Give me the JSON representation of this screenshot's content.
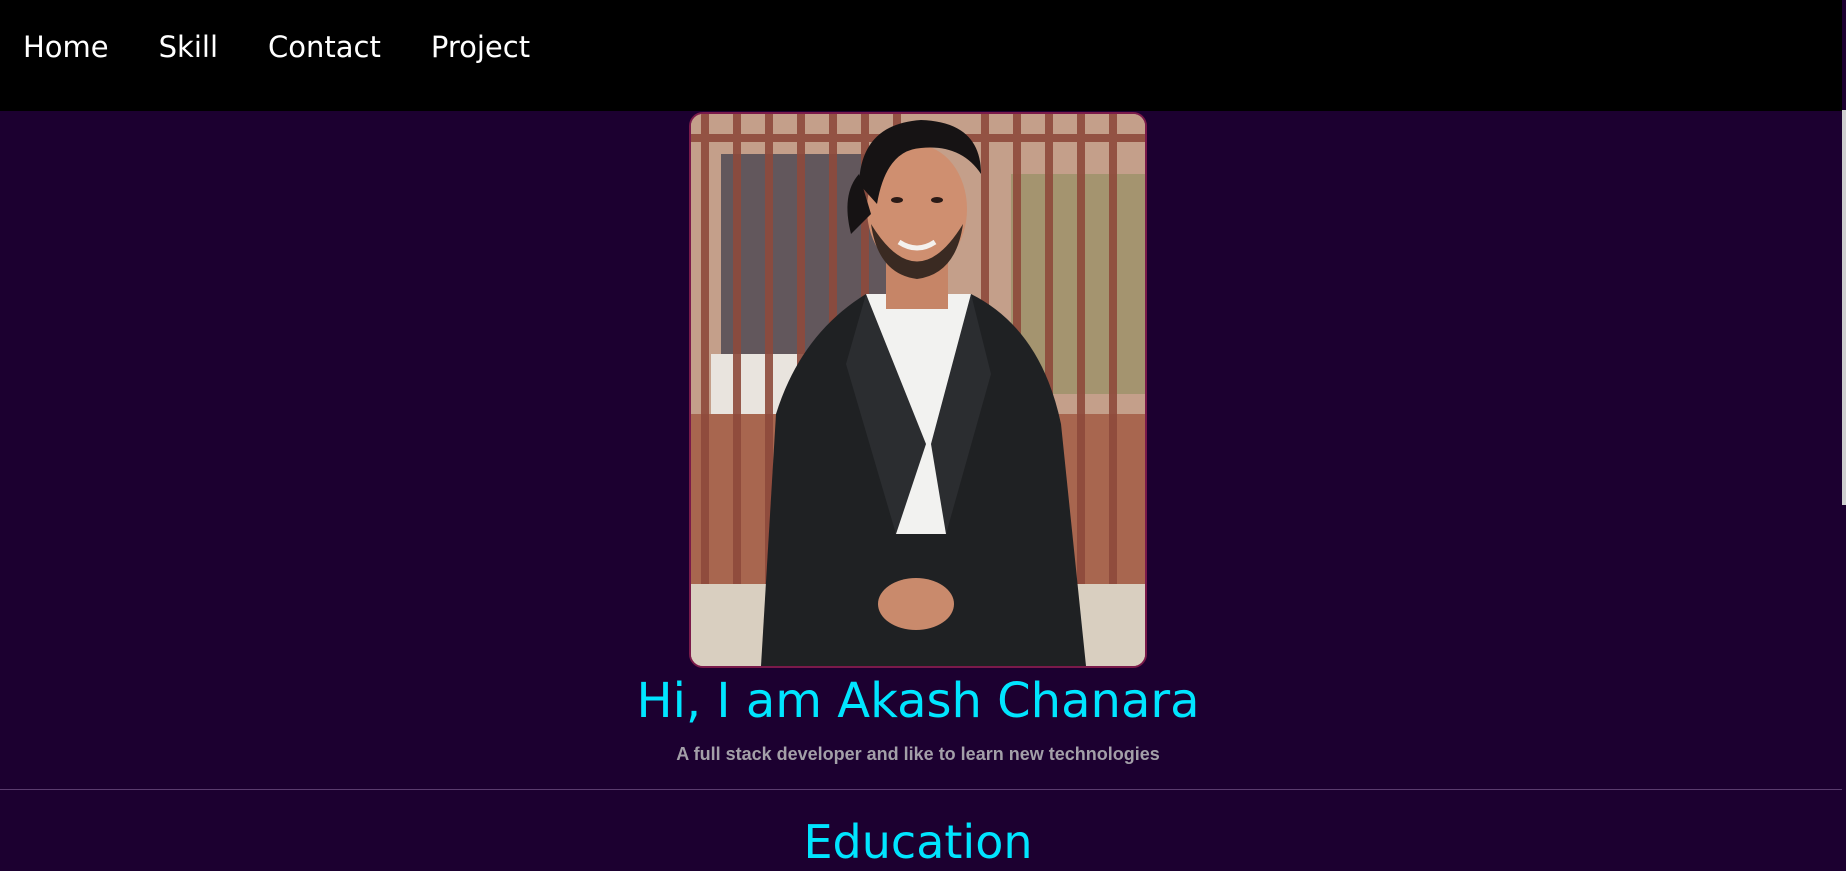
{
  "nav": {
    "items": [
      {
        "label": "Home"
      },
      {
        "label": "Skill"
      },
      {
        "label": "Contact"
      },
      {
        "label": "Project"
      }
    ]
  },
  "hero": {
    "photo_alt": "Portrait of Akash Chanara",
    "title": "Hi, I am Akash Chanara",
    "subtitle": "A full stack developer and like to learn new technologies"
  },
  "education": {
    "title": "Education"
  },
  "colors": {
    "page_background": "#1c0030",
    "navbar_background": "#000000",
    "accent_heading": "#00e5ff",
    "subtitle_text": "#a39fa8",
    "photo_border": "#7a1a4a"
  }
}
